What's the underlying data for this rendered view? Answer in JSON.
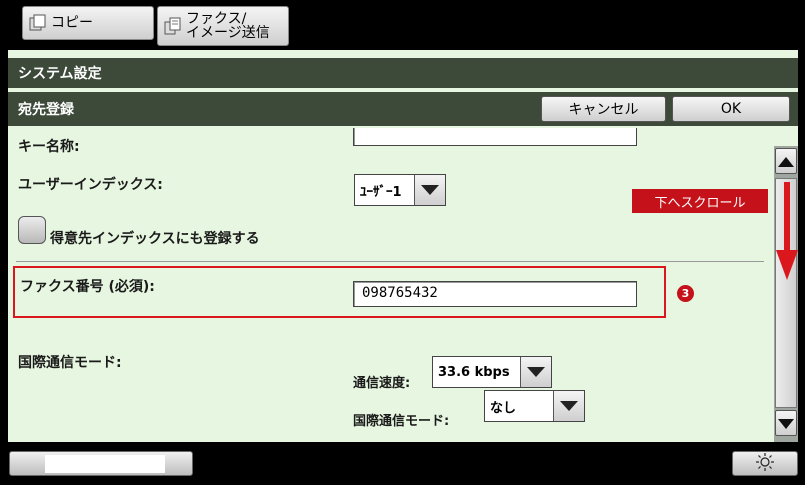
{
  "tabs": {
    "copy": "コピー",
    "fax_line1": "ファクス/",
    "fax_line2": "イメージ送信"
  },
  "header": {
    "system_title": "システム設定",
    "section_title": "宛先登録",
    "cancel_label": "キャンセル",
    "ok_label": "OK"
  },
  "form": {
    "key_name_label": "キー名称:",
    "user_index_label": "ユーザーインデックス:",
    "user_index_value": "ﾕｰｻﾞｰ1",
    "register_checkbox_label": "得意先インデックスにも登録する",
    "fax_number_label": "ファクス番号 (必須):",
    "fax_number_value": "098765432",
    "intl_mode_label": "国際通信モード:",
    "speed_label": "通信速度:",
    "speed_value": "33.6 kbps",
    "intl_mode_sub_label": "国際通信モード:",
    "intl_mode_value": "なし"
  },
  "annotations": {
    "scroll_down_callout": "下へスクロール",
    "step_number": "3"
  },
  "colors": {
    "panel_bg": "#e7f6e0",
    "header_bar": "#3d4a3a",
    "highlight_red": "#d9171c",
    "callout_red": "#c4111a"
  }
}
